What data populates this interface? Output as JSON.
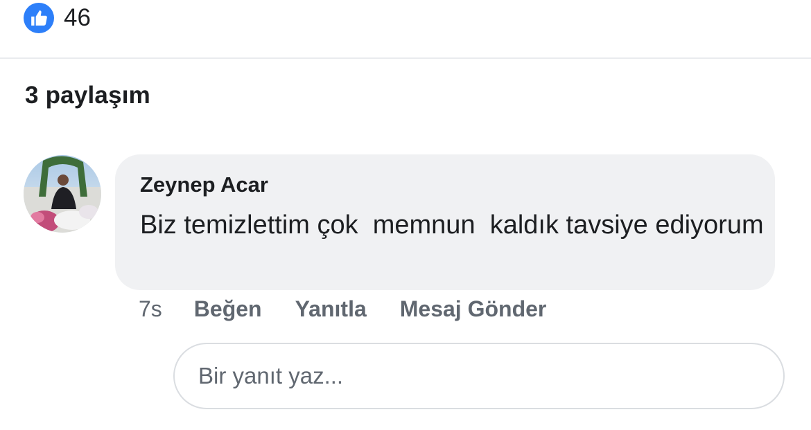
{
  "reactions": {
    "like_count": "46",
    "icon": "thumbs-up-icon",
    "color": "#2d7ff9"
  },
  "post_stats": {
    "shares": "3 paylaşım"
  },
  "comment": {
    "author": "Zeynep Acar",
    "text": "Biz temizlettim çok  memnun  kaldık tavsiye ediyorum",
    "time": "7s",
    "actions": {
      "like": "Beğen",
      "reply": "Yanıtla",
      "message": "Mesaj Gönder"
    }
  },
  "reply_box": {
    "placeholder": "Bir yanıt yaz..."
  }
}
